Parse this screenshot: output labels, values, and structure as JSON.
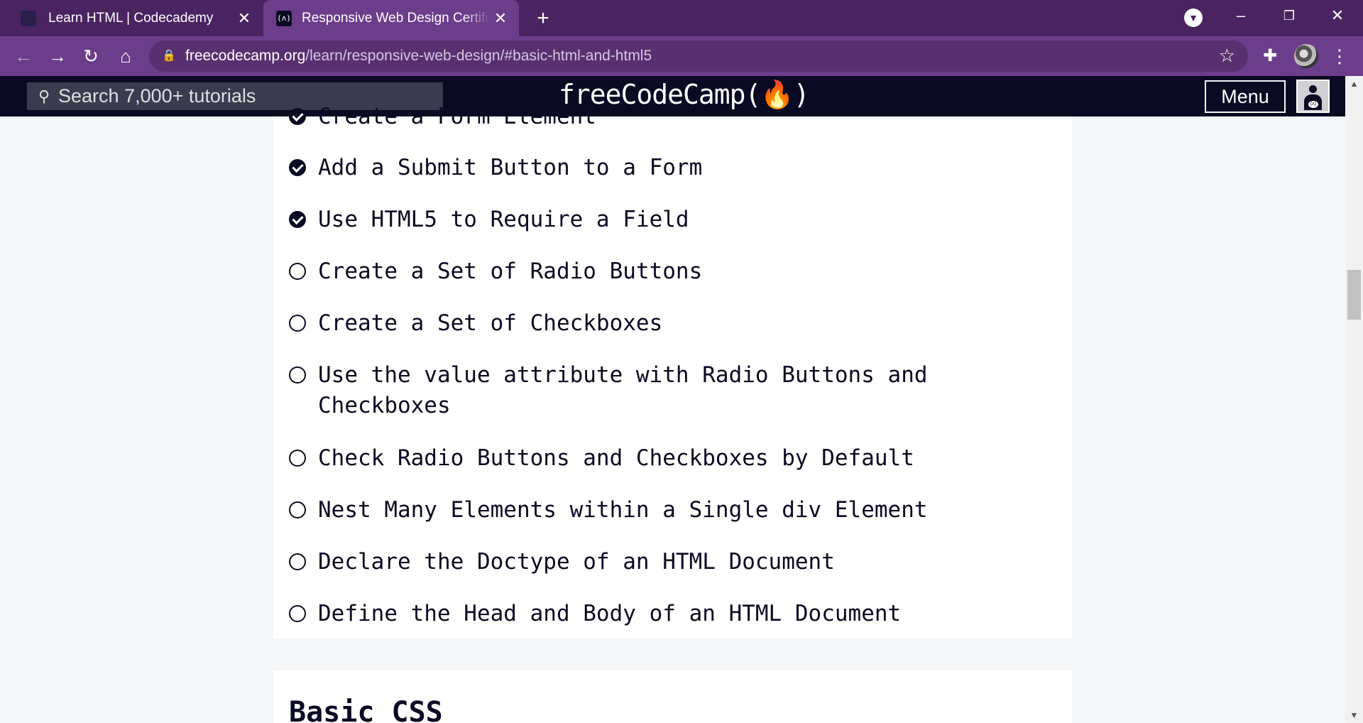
{
  "browser": {
    "tabs": [
      {
        "title": "Learn HTML | Codecademy",
        "active": false
      },
      {
        "title": "Responsive Web Design Certification",
        "active": true
      }
    ],
    "new_tab_symbol": "+",
    "url_domain": "freecodecamp.org",
    "url_path": "/learn/responsive-web-design/#basic-html-and-html5",
    "accent_color": "#6b3d8a",
    "tabbar_color": "#4a2461"
  },
  "site": {
    "search_placeholder": "Search 7,000+ tutorials",
    "brand": "freeCodeCamp(🔥)",
    "menu_label": "Menu",
    "nav_color": "#0a0a23"
  },
  "lessons": [
    {
      "title": "Add a Submit Button to a Form",
      "completed": true
    },
    {
      "title": "Use HTML5 to Require a Field",
      "completed": true
    },
    {
      "title": "Create a Set of Radio Buttons",
      "completed": false
    },
    {
      "title": "Create a Set of Checkboxes",
      "completed": false
    },
    {
      "title": "Use the value attribute with Radio Buttons and Checkboxes",
      "completed": false
    },
    {
      "title": "Check Radio Buttons and Checkboxes by Default",
      "completed": false
    },
    {
      "title": "Nest Many Elements within a Single div Element",
      "completed": false
    },
    {
      "title": "Declare the Doctype of an HTML Document",
      "completed": false
    },
    {
      "title": "Define the Head and Body of an HTML Document",
      "completed": false
    }
  ],
  "partial_lesson": {
    "title": "Create a Form Element",
    "completed": true
  },
  "next_section": {
    "title": "Basic CSS"
  }
}
